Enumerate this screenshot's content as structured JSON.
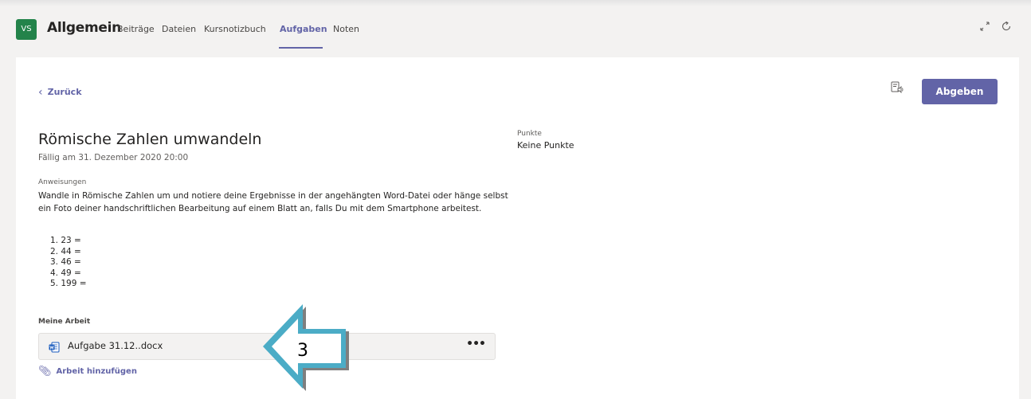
{
  "header": {
    "team_initials": "VS",
    "channel": "Allgemein",
    "tabs": [
      "Beiträge",
      "Dateien",
      "Kursnotizbuch",
      "Aufgaben",
      "Noten"
    ],
    "active_tab": "Aufgaben",
    "icons": [
      "expand-icon",
      "refresh-icon"
    ]
  },
  "toolbar": {
    "back_label": "Zurück",
    "submit_label": "Abgeben",
    "immersive_reader_icon": "immersive-reader-icon"
  },
  "assignment": {
    "title": "Römische Zahlen umwandeln",
    "due": "Fällig am 31. Dezember 2020 20:00",
    "points_label": "Punkte",
    "points_value": "Keine Punkte",
    "instructions_label": "Anweisungen",
    "instructions": "Wandle in Römische Zahlen um und notiere deine Ergebnisse in der angehängten Word-Datei oder hänge selbst ein Foto deiner handschriftlichen Bearbeitung auf einem Blatt an, falls Du mit dem Smartphone arbeitest.",
    "list": [
      "1. 23 =",
      "2. 44 =",
      "3. 46 =",
      "4. 49 =",
      "5. 199 ="
    ]
  },
  "my_work": {
    "label": "Meine Arbeit",
    "file_name": "Aufgabe 31.12..docx",
    "more_label": "•••",
    "add_label": "Arbeit hinzufügen"
  },
  "annotation": {
    "number": "3",
    "arrow_color": "#4bacc6"
  },
  "colors": {
    "accent": "#6264a7",
    "team_avatar": "#23834a",
    "word": "#185abd"
  }
}
